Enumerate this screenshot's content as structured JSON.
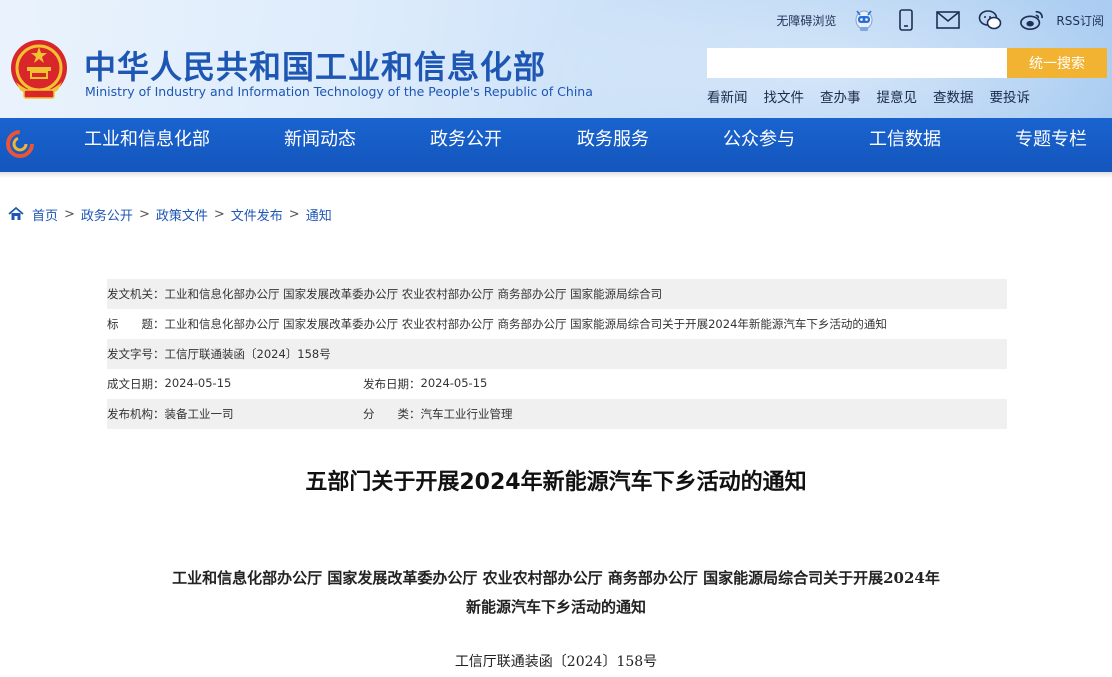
{
  "header": {
    "site_title_cn": "中华人民共和国工业和信息化部",
    "site_title_en": "Ministry of Industry and Information Technology of the People's Republic of China",
    "accessibility_label": "无障碍浏览",
    "rss_label": "RSS订阅",
    "icons": [
      "robot-assistant-icon",
      "mobile-icon",
      "mail-icon",
      "wechat-icon",
      "weibo-icon"
    ],
    "search": {
      "placeholder": "",
      "value": "",
      "button_label": "统一搜索"
    },
    "quick_links": [
      "看新闻",
      "找文件",
      "查办事",
      "提意见",
      "查数据",
      "要投诉"
    ]
  },
  "nav": {
    "items": [
      "工业和信息化部",
      "新闻动态",
      "政务公开",
      "政务服务",
      "公众参与",
      "工信数据",
      "专题专栏"
    ]
  },
  "breadcrumb": [
    "首页",
    "政务公开",
    "政策文件",
    "文件发布",
    "通知"
  ],
  "meta": {
    "issuer_label": "发文机关：",
    "issuer": "工业和信息化部办公厅 国家发展改革委办公厅 农业农村部办公厅 商务部办公厅 国家能源局综合司",
    "title_label": "标　　题：",
    "title": "工业和信息化部办公厅 国家发展改革委办公厅 农业农村部办公厅 商务部办公厅 国家能源局综合司关于开展2024年新能源汽车下乡活动的通知",
    "docno_label": "发文字号：",
    "docno": "工信厅联通装函〔2024〕158号",
    "created_label": "成文日期：",
    "created": "2024-05-15",
    "published_label": "发布日期：",
    "published": "2024-05-15",
    "org_label": "发布机构：",
    "org": "装备工业一司",
    "category_label": "分　　类：",
    "category": "汽车工业行业管理"
  },
  "article": {
    "title": "五部门关于开展2024年新能源汽车下乡活动的通知",
    "subtitle_line1": "工业和信息化部办公厅  国家发展改革委办公厅  农业农村部办公厅  商务部办公厅  国家能源局综合司关于开展2024年",
    "subtitle_line2": "新能源汽车下乡活动的通知",
    "doc_number": "工信厅联通装函〔2024〕158号"
  },
  "colors": {
    "brand_blue": "#1e56b3",
    "nav_blue": "#1a63cf",
    "search_button": "#f3b332",
    "row_gray": "#f0f0f0"
  }
}
